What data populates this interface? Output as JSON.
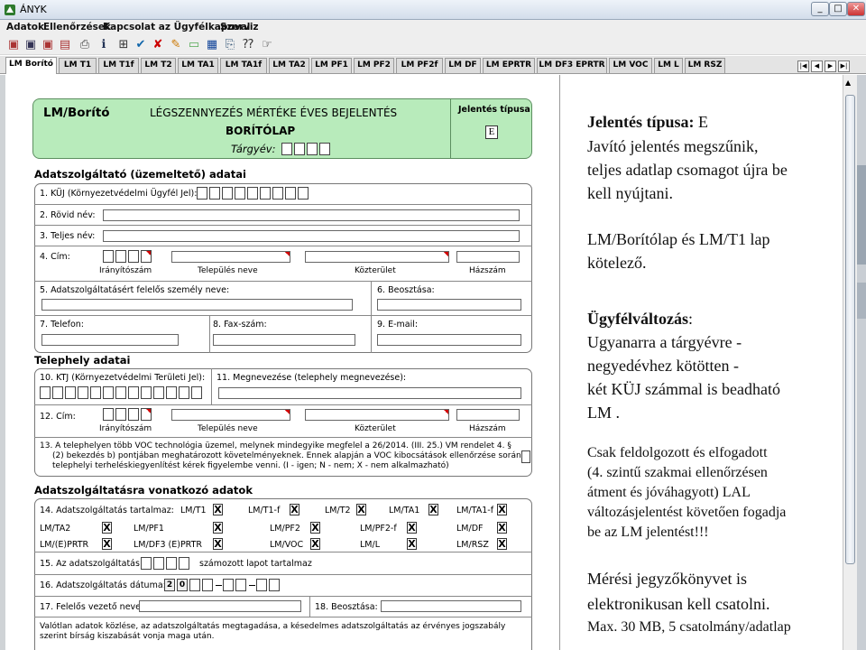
{
  "window": {
    "title": "ÁNYK",
    "controls": [
      "_",
      "□",
      "✕"
    ]
  },
  "menu": [
    "Adatok",
    "Ellenőrzések",
    "Kapcsolat az Ügyfélkapuval",
    "Szerviz"
  ],
  "toolbar_icons": [
    "new-icon",
    "save-icon",
    "save-as-icon",
    "import-icon",
    "print-icon",
    "info-icon",
    "check-icon",
    "delete-icon",
    "edit-icon",
    "folder-icon",
    "stack-icon",
    "attach-icon",
    "help-icon",
    "hand-icon"
  ],
  "tabs": [
    "LM Borító",
    "LM T1",
    "LM T1f",
    "LM T2",
    "LM TA1",
    "LM TA1f",
    "LM TA2",
    "LM PF1",
    "LM PF2",
    "LM PF2f",
    "LM DF",
    "LM EPRTR",
    "LM DF3 EPRTR",
    "LM VOC",
    "LM L",
    "LM RSZ"
  ],
  "nav_buttons": [
    "|◀",
    "◀",
    "▶",
    "▶|"
  ],
  "form": {
    "code": "LM/Borító",
    "title": "LÉGSZENNYEZÉS MÉRTÉKE ÉVES BEJELENTÉS",
    "subtitle": "BORÍTÓLAP",
    "year_label": "Tárgyév:",
    "report_type_label": "Jelentés típusa",
    "report_type_value": "E",
    "sec1": "Adatszolgáltató (üzemeltető) adatai",
    "f1": "1. KÜJ (Környezetvédelmi Ügyfél Jel):",
    "f2": "2. Rövid név:",
    "f3": "3. Teljes név:",
    "f4": "4. Cím:",
    "addr_zip": "Irányítószám",
    "addr_city": "Település neve",
    "addr_street": "Közterület",
    "addr_house": "Házszám",
    "f5": "5. Adatszolgáltatásért felelős személy neve:",
    "f6": "6. Beosztása:",
    "f7": "7. Telefon:",
    "f8": "8. Fax-szám:",
    "f9": "9. E-mail:",
    "sec2": "Telephely adatai",
    "f10": "10. KTJ (Környezetvédelmi Területi Jel):",
    "f11": "11. Megnevezése (telephely megnevezése):",
    "f12": "12. Cím:",
    "f13_l1": "13. A telephelyen több VOC technológia üzemel, melynek mindegyike megfelel a 26/2014. (III. 25.) VM rendelet 4. §",
    "f13_l2": "(2) bekezdés b) pontjában meghatározott követelményeknek. Ennek alapján a VOC kibocsátások ellenőrzése során",
    "f13_l3": "telephelyi terheléskiegyenlítést kérek figyelembe venni. (I - igen; N - nem; X - nem alkalmazható)",
    "sec3": "Adatszolgáltatásra vonatkozó adatok",
    "f14": "14. Adatszolgáltatás tartalmaz:",
    "grid": [
      [
        "LM/T1",
        "LM/T1-f",
        "LM/T2",
        "LM/TA1",
        "LM/TA1-f"
      ],
      [
        "LM/TA2",
        "LM/PF1",
        "LM/PF2",
        "LM/PF2-f",
        "LM/DF"
      ],
      [
        "LM/(E)PRTR",
        "LM/DF3 (E)PRTR",
        "LM/VOC",
        "LM/L",
        "LM/RSZ"
      ]
    ],
    "x_mark": "X",
    "f15": "15. Az adatszolgáltatás",
    "f15b": "számozott lapot tartalmaz",
    "f16": "16. Adatszolgáltatás dátuma:",
    "date_prefix": "2",
    "date_prefix2": "0",
    "f17": "17. Felelős vezető neve:",
    "f18": "18. Beosztása:",
    "footer_l1": "Valótlan adatok közlése, az adatszolgáltatás megtagadása, a késedelmes adatszolgáltatás az érvényes jogszabály",
    "footer_l2": "szerint bírság kiszabását vonja maga után."
  },
  "notes": {
    "p1_bold": "Jelentés típusa:",
    "p1_val": " E",
    "p1_l2": "Javító jelentés megszűnik,",
    "p1_l3": "teljes adatlap csomagot újra be",
    "p1_l4": "kell nyújtani.",
    "p2_l1": "LM/Borítólap és LM/T1 lap",
    "p2_l2": "kötelező.",
    "p3_bold": "Ügyfélváltozás",
    "p3_colon": ":",
    "p3_l2": "Ugyanarra a tárgyévre -",
    "p3_l3": "negyedévhez kötötten -",
    "p3_l4": "két KÜJ számmal is beadható",
    "p3_l5": "LM .",
    "p4_l1": "Csak feldolgozott és elfogadott",
    "p4_l2": "(4. szintű szakmai ellenőrzésen",
    "p4_l3": "átment és jóváhagyott) LAL",
    "p4_l4": "változásjelentést követően fogadja",
    "p4_l5": "be az LM jelentést!!!",
    "p5_l1": "Mérési jegyzőkönyvet is",
    "p5_l2": "elektronikusan kell csatolni.",
    "p5_l3": "Max. 30 MB, 5 csatolmány/adatlap"
  }
}
